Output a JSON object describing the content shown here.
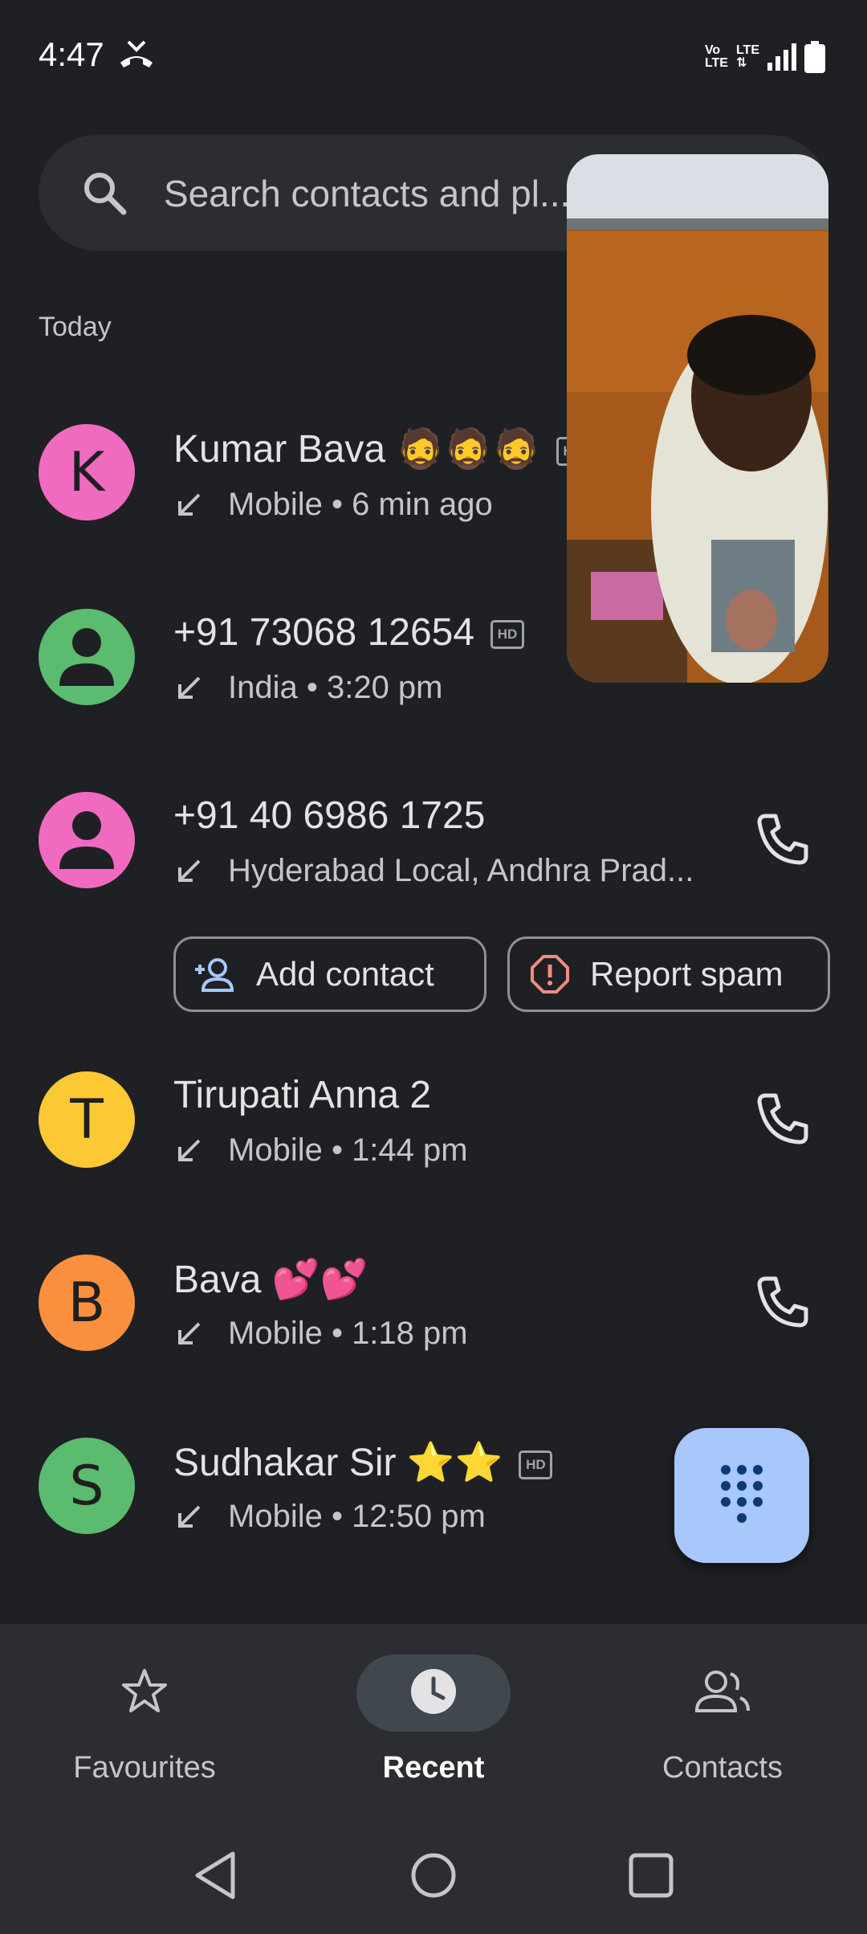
{
  "status_bar": {
    "time": "4:47",
    "icons": [
      "missed-call-icon",
      "volte-icon",
      "lte-icon",
      "signal-icon",
      "battery-icon"
    ]
  },
  "search": {
    "placeholder": "Search contacts and pl..."
  },
  "section": {
    "label": "Today"
  },
  "calls": [
    {
      "initial": "K",
      "avatar_color": "#f06ac0",
      "name": "Kumar Bava 🧔🧔🧔",
      "hd": true,
      "detail": "Mobile • 6 min ago"
    },
    {
      "initial": "",
      "avatar_color": "#5bbb6f",
      "name": "+91 73068 12654",
      "hd": true,
      "detail": "India • 3:20 pm"
    },
    {
      "initial": "",
      "avatar_color": "#f06ac0",
      "name": "+91 40 6986 1725",
      "hd": false,
      "detail": "Hyderabad Local, Andhra Prad..."
    },
    {
      "initial": "T",
      "avatar_color": "#fcc934",
      "name": "Tirupati Anna 2",
      "hd": false,
      "detail": "Mobile • 1:44 pm"
    },
    {
      "initial": "B",
      "avatar_color": "#fa903e",
      "name": "Bava 💕💕",
      "hd": false,
      "detail": "Mobile • 1:18 pm"
    },
    {
      "initial": "S",
      "avatar_color": "#5bbb6f",
      "name": "Sudhakar Sir ⭐⭐",
      "hd": true,
      "detail": "Mobile • 12:50 pm"
    }
  ],
  "actions": {
    "add_contact": "Add contact",
    "report_spam": "Report spam"
  },
  "nav": {
    "favourites": "Favourites",
    "recent": "Recent",
    "contacts": "Contacts",
    "selected": "recent"
  },
  "colors": {
    "background": "#1f2023",
    "surface": "#2b2d31",
    "fab": "#a8c7fa",
    "accent_blue": "#a8c7fa",
    "spam_red": "#f28b82"
  }
}
